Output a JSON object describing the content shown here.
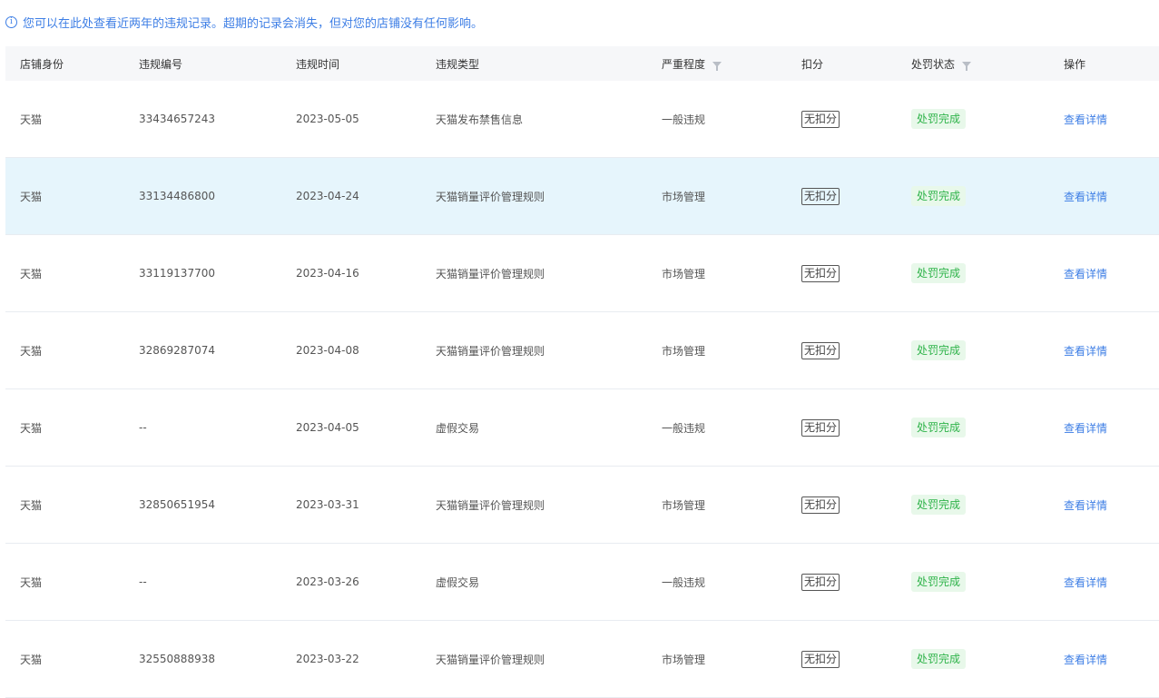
{
  "notice": {
    "icon": "info-icon",
    "text": "您可以在此处查看近两年的违规记录。超期的记录会消失，但对您的店铺没有任何影响。"
  },
  "table": {
    "columns": [
      "店铺身份",
      "违规编号",
      "违规时间",
      "违规类型",
      "严重程度",
      "扣分",
      "处罚状态",
      "操作"
    ],
    "rows": [
      {
        "identity": "天猫",
        "id": "33434657243",
        "date": "2023-05-05",
        "type": "天猫发布禁售信息",
        "severity": "一般违规",
        "deduct": "无扣分",
        "status": "处罚完成",
        "action": "查看详情"
      },
      {
        "identity": "天猫",
        "id": "33134486800",
        "date": "2023-04-24",
        "type": "天猫销量评价管理规则",
        "severity": "市场管理",
        "deduct": "无扣分",
        "status": "处罚完成",
        "action": "查看详情"
      },
      {
        "identity": "天猫",
        "id": "33119137700",
        "date": "2023-04-16",
        "type": "天猫销量评价管理规则",
        "severity": "市场管理",
        "deduct": "无扣分",
        "status": "处罚完成",
        "action": "查看详情"
      },
      {
        "identity": "天猫",
        "id": "32869287074",
        "date": "2023-04-08",
        "type": "天猫销量评价管理规则",
        "severity": "市场管理",
        "deduct": "无扣分",
        "status": "处罚完成",
        "action": "查看详情"
      },
      {
        "identity": "天猫",
        "id": "--",
        "date": "2023-04-05",
        "type": "虚假交易",
        "severity": "一般违规",
        "deduct": "无扣分",
        "status": "处罚完成",
        "action": "查看详情"
      },
      {
        "identity": "天猫",
        "id": "32850651954",
        "date": "2023-03-31",
        "type": "天猫销量评价管理规则",
        "severity": "市场管理",
        "deduct": "无扣分",
        "status": "处罚完成",
        "action": "查看详情"
      },
      {
        "identity": "天猫",
        "id": "--",
        "date": "2023-03-26",
        "type": "虚假交易",
        "severity": "一般违规",
        "deduct": "无扣分",
        "status": "处罚完成",
        "action": "查看详情"
      },
      {
        "identity": "天猫",
        "id": "32550888938",
        "date": "2023-03-22",
        "type": "天猫销量评价管理规则",
        "severity": "市场管理",
        "deduct": "无扣分",
        "status": "处罚完成",
        "action": "查看详情"
      }
    ]
  },
  "colors": {
    "accent": "#3d7ee5",
    "status_green": "#2fb34a",
    "status_green_bg": "#e8f8ea",
    "row_highlight": "#e6f5fc",
    "header_bg": "#f6f7f9"
  }
}
